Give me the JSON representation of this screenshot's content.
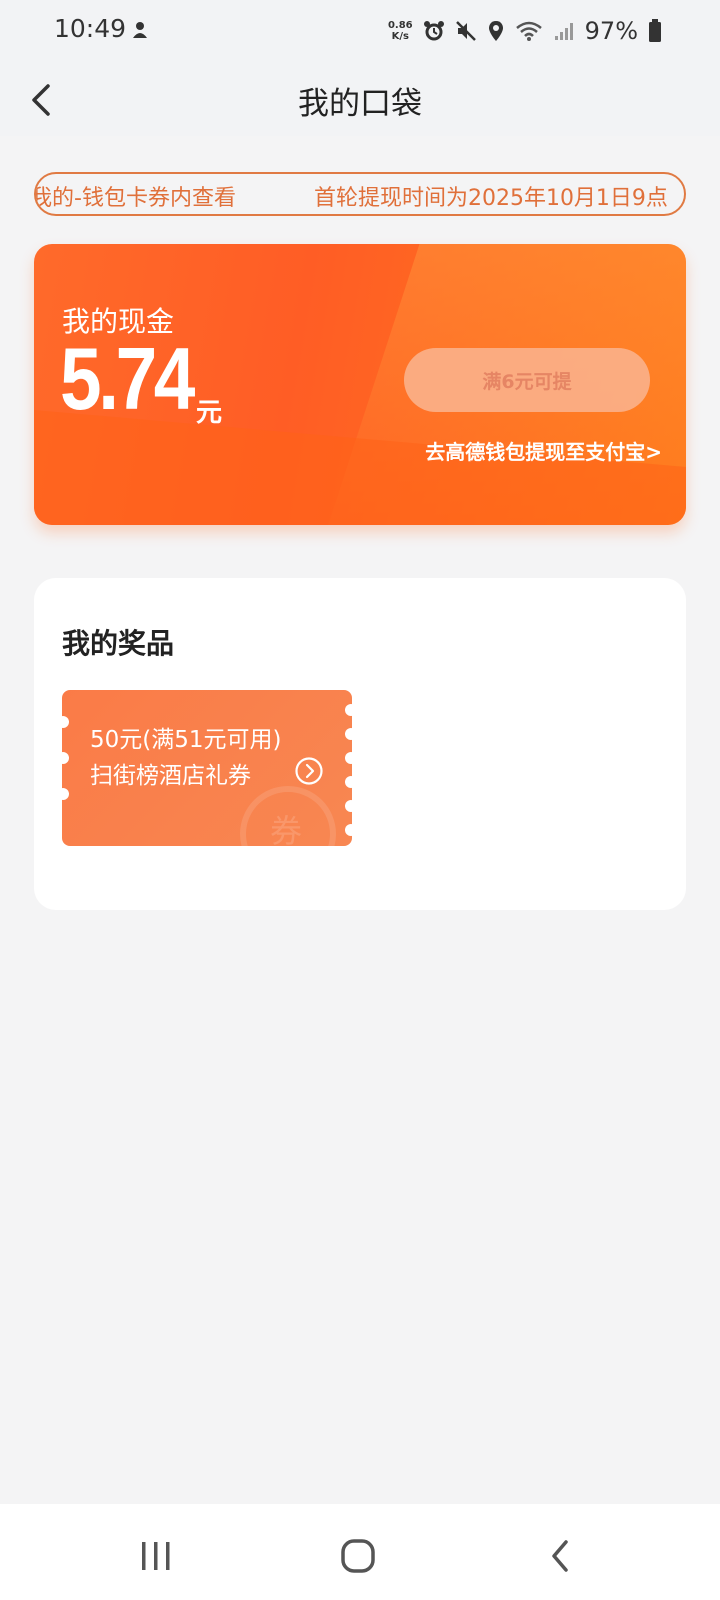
{
  "status_bar": {
    "time": "10:49",
    "net_speed_value": "0.86",
    "net_speed_unit": "K/s",
    "battery": "97%"
  },
  "header": {
    "title": "我的口袋"
  },
  "marquee": {
    "text_a": "我的-钱包卡券内查看",
    "text_b": "首轮提现时间为2025年10月1日9点"
  },
  "cash": {
    "label": "我的现金",
    "amount": "5.74",
    "unit": "元",
    "withdraw_button": "满6元可提",
    "wallet_link": "去高德钱包提现至支付宝>"
  },
  "prizes": {
    "title": "我的奖品",
    "coupons": [
      {
        "line1": "50元(满51元可用)",
        "line2": "扫街榜酒店礼券",
        "watermark": "券"
      }
    ]
  },
  "colors": {
    "accent": "#ff6a2a",
    "marquee_border": "#e07a43",
    "coupon": "#fa7b47"
  }
}
